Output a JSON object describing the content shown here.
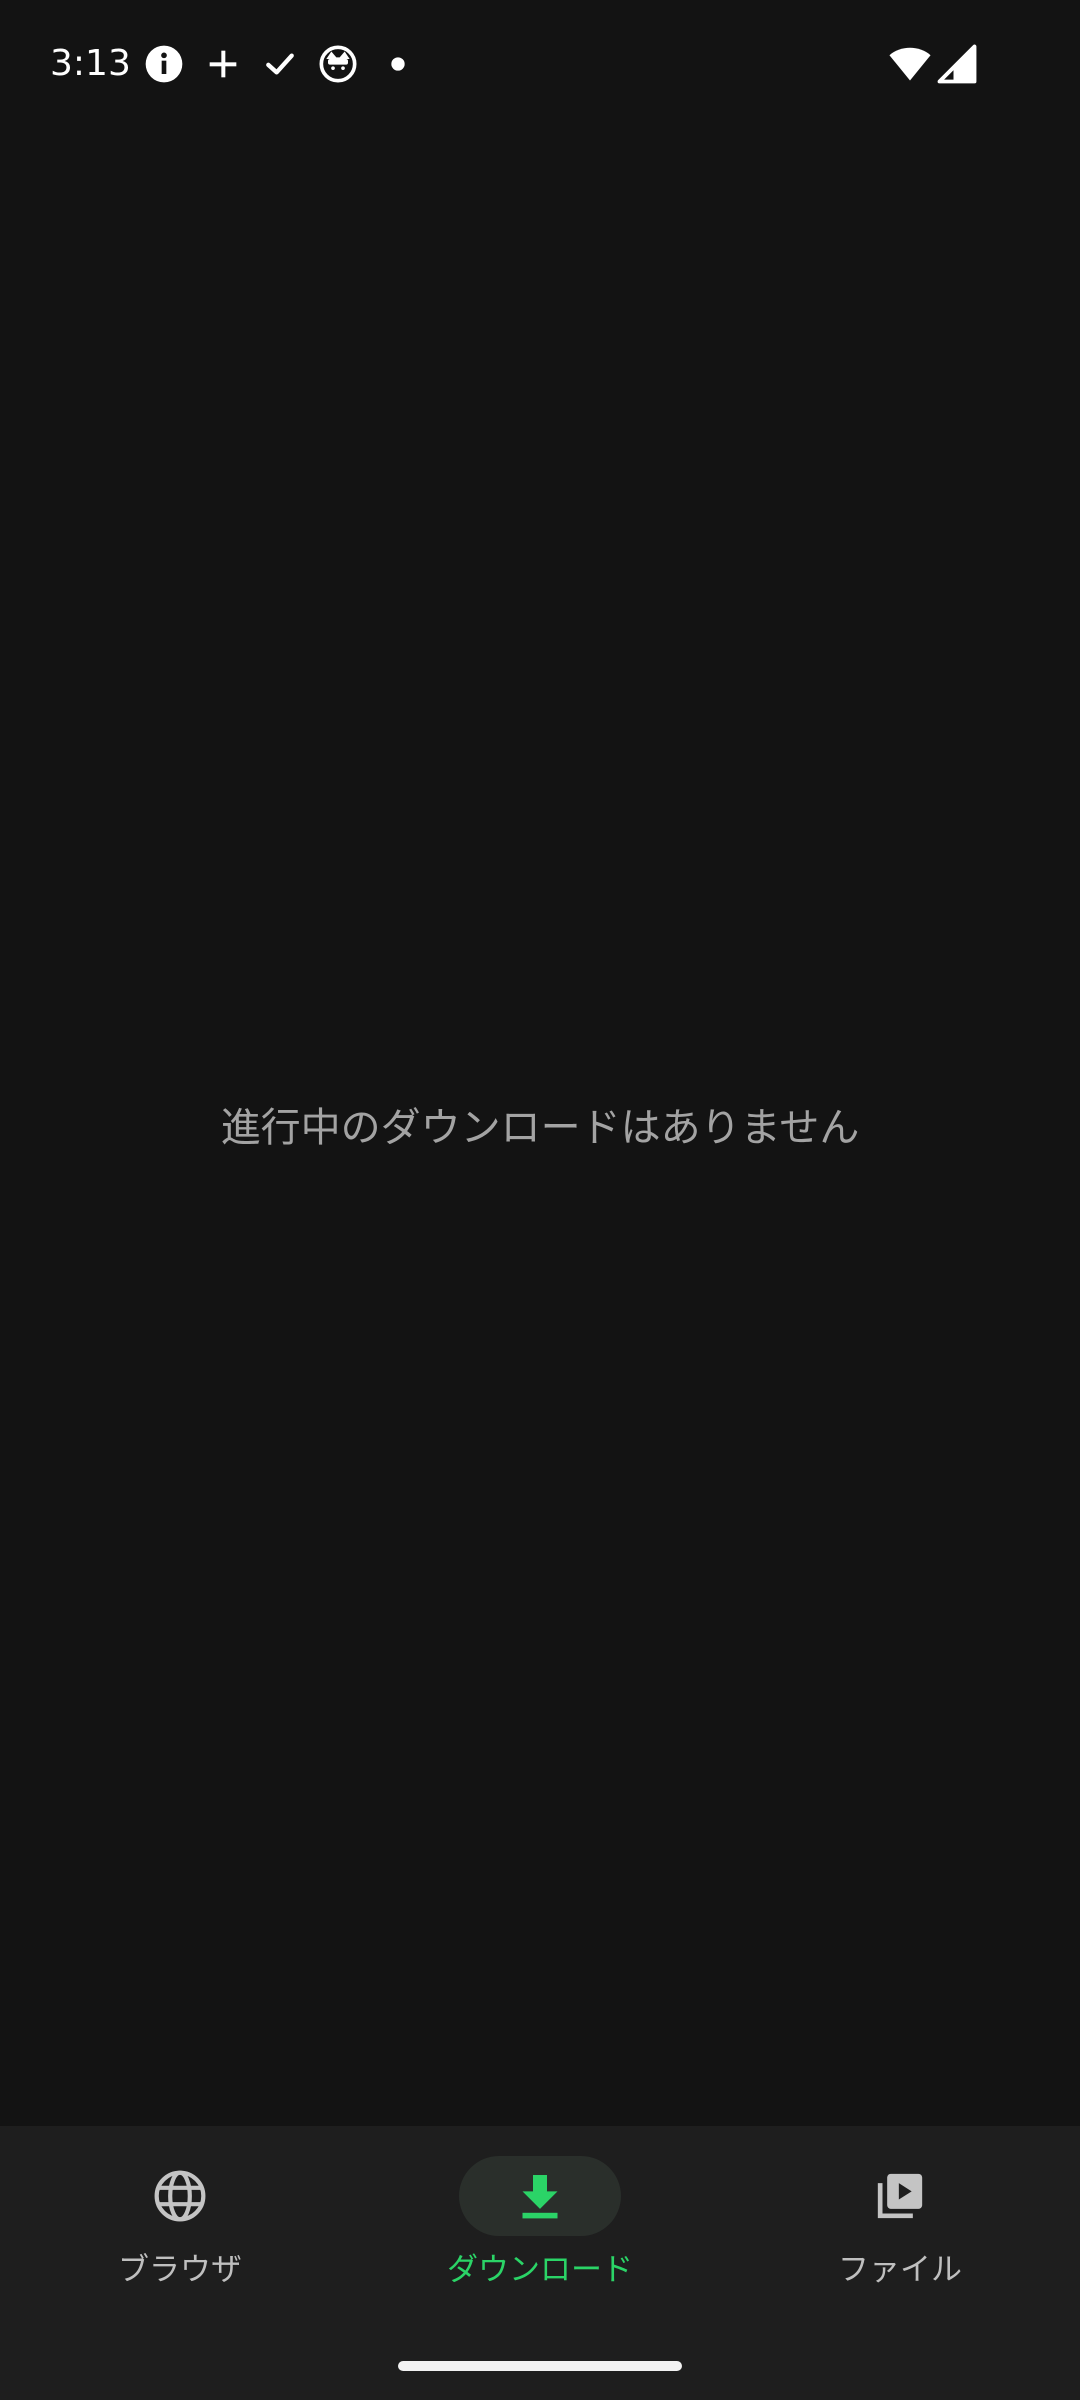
{
  "status_bar": {
    "time": "3:13",
    "icons": [
      "info-icon",
      "plus-icon",
      "check-icon",
      "cat-face-icon",
      "dot-icon",
      "wifi-icon",
      "signal-icon"
    ]
  },
  "main": {
    "empty_message": "進行中のダウンロードはありません"
  },
  "bottom_nav": {
    "active_index": 1,
    "active_color": "#2bd467",
    "items": [
      {
        "label": "ブラウザ",
        "icon": "globe-icon"
      },
      {
        "label": "ダウンロード",
        "icon": "download-icon"
      },
      {
        "label": "ファイル",
        "icon": "video-library-icon"
      }
    ]
  }
}
